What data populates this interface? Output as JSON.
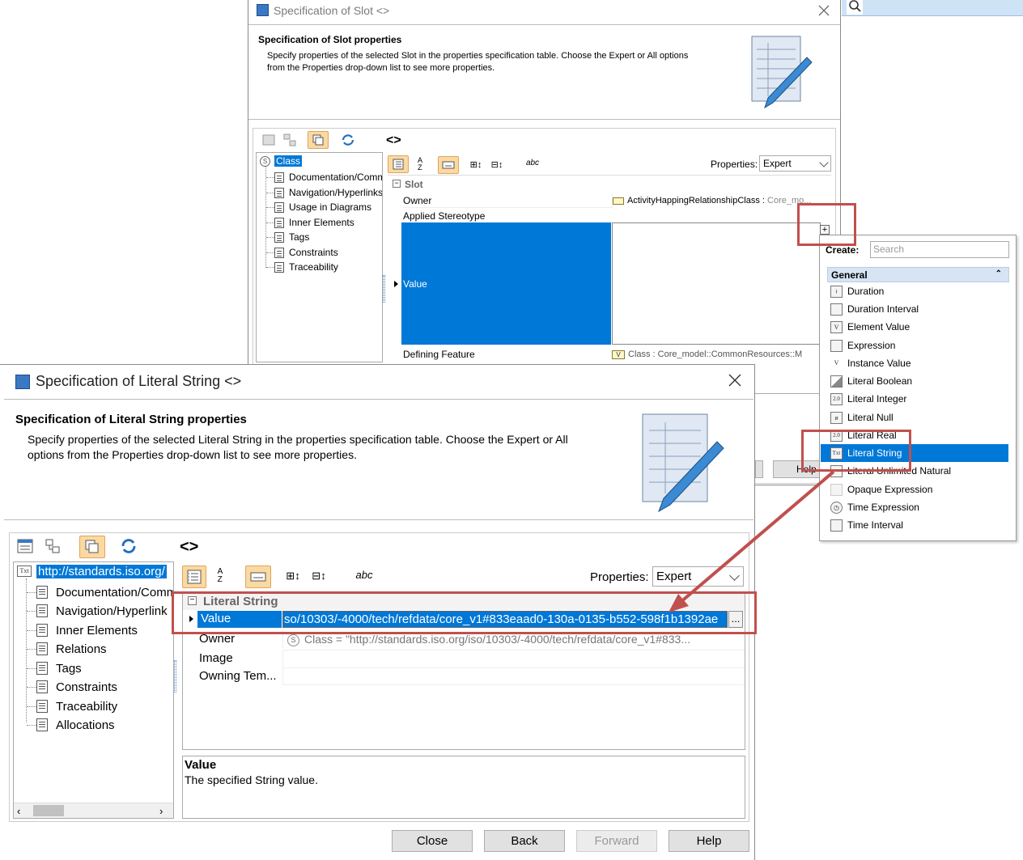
{
  "slot_dialog": {
    "title": "Specification of Slot <>",
    "header_title": "Specification of Slot properties",
    "header_desc_1": "Specify properties of the selected Slot in the properties specification table. Choose the Expert or All options",
    "header_desc_2": "from the Properties drop-down list to see more properties.",
    "path": "<>",
    "tree": [
      "Class",
      "Documentation/Comm",
      "Navigation/Hyperlinks",
      "Usage in Diagrams",
      "Inner Elements",
      "Tags",
      "Constraints",
      "Traceability"
    ],
    "properties_label": "Properties:",
    "properties_value": "Expert",
    "group": "Slot",
    "rows": [
      {
        "name": "Owner",
        "value": "ActivityHappingRelationshipClass :",
        "value_grey": " Core_mo..."
      },
      {
        "name": "Applied Stereotype",
        "value": ""
      },
      {
        "name": "Value",
        "value": ""
      },
      {
        "name": "Defining Feature",
        "value": "Class : Core_model::CommonResources::M"
      }
    ],
    "help_partial": "Help"
  },
  "create_menu": {
    "label": "Create:",
    "search_placeholder": "Search",
    "section": "General",
    "items": [
      "Duration",
      "Duration Interval",
      "Element Value",
      "Expression",
      "Instance Value",
      "Literal Boolean",
      "Literal Integer",
      "Literal Null",
      "Literal Real",
      "Literal String",
      "Literal Unlimited Natural",
      "Opaque Expression",
      "Time Expression",
      "Time Interval"
    ],
    "icon_labels": [
      "",
      "",
      "V",
      "",
      "V",
      "",
      "2.0",
      "",
      "2.0",
      "Txt",
      "",
      "",
      "",
      ""
    ]
  },
  "ls_dialog": {
    "title": "Specification of Literal String <>",
    "header_title": "Specification of Literal String properties",
    "header_desc_1": "Specify properties of the selected Literal String in the properties specification table. Choose the Expert or All",
    "header_desc_2": "options from the Properties drop-down list to see more properties.",
    "path": "<>",
    "tree": [
      "http://standards.iso.org/",
      "Documentation/Comm",
      "Navigation/Hyperlink",
      "Inner Elements",
      "Relations",
      "Tags",
      "Constraints",
      "Traceability",
      "Allocations"
    ],
    "properties_label": "Properties:",
    "properties_value": "Expert",
    "group": "Literal String",
    "value_name": "Value",
    "value_text": "so/10303/-4000/tech/refdata/core_v1#833eaad0-130a-0135-b552-598f1b1392ae",
    "value_more": "...",
    "rows": [
      {
        "name": "Owner",
        "value": "Class = \"http://standards.iso.org/iso/10303/-4000/tech/refdata/core_v1#833..."
      },
      {
        "name": "Image",
        "value": ""
      },
      {
        "name": "Owning Tem...",
        "value": ""
      }
    ],
    "desc_title": "Value",
    "desc_text": "The specified String value.",
    "buttons": {
      "close": "Close",
      "back": "Back",
      "forward": "Forward",
      "help": "Help"
    }
  },
  "colors": {
    "selection": "#0078d7",
    "highlight_box": "#c0504d",
    "toggle_on": "#fbd9a3"
  }
}
